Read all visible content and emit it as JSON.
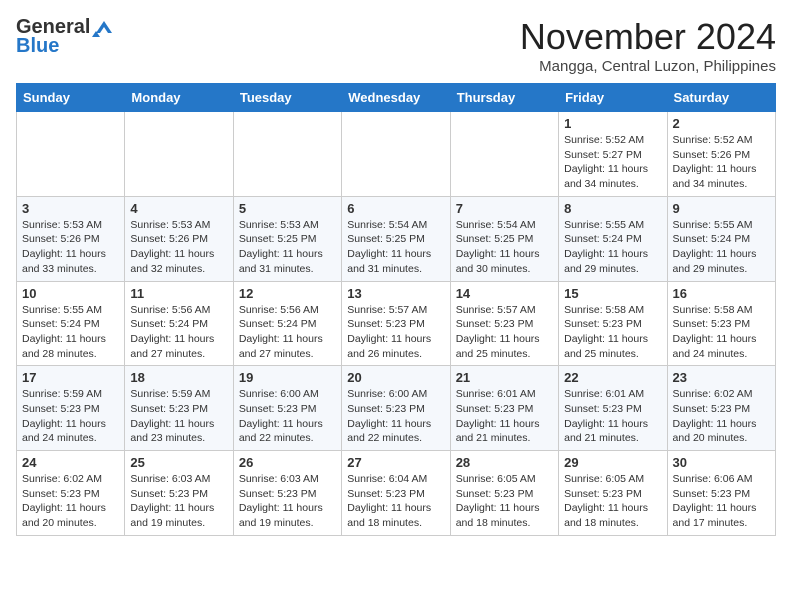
{
  "header": {
    "logo_line1": "General",
    "logo_line2": "Blue",
    "month_title": "November 2024",
    "subtitle": "Mangga, Central Luzon, Philippines"
  },
  "weekdays": [
    "Sunday",
    "Monday",
    "Tuesday",
    "Wednesday",
    "Thursday",
    "Friday",
    "Saturday"
  ],
  "weeks": [
    [
      {
        "day": "",
        "info": ""
      },
      {
        "day": "",
        "info": ""
      },
      {
        "day": "",
        "info": ""
      },
      {
        "day": "",
        "info": ""
      },
      {
        "day": "",
        "info": ""
      },
      {
        "day": "1",
        "info": "Sunrise: 5:52 AM\nSunset: 5:27 PM\nDaylight: 11 hours and 34 minutes."
      },
      {
        "day": "2",
        "info": "Sunrise: 5:52 AM\nSunset: 5:26 PM\nDaylight: 11 hours and 34 minutes."
      }
    ],
    [
      {
        "day": "3",
        "info": "Sunrise: 5:53 AM\nSunset: 5:26 PM\nDaylight: 11 hours and 33 minutes."
      },
      {
        "day": "4",
        "info": "Sunrise: 5:53 AM\nSunset: 5:26 PM\nDaylight: 11 hours and 32 minutes."
      },
      {
        "day": "5",
        "info": "Sunrise: 5:53 AM\nSunset: 5:25 PM\nDaylight: 11 hours and 31 minutes."
      },
      {
        "day": "6",
        "info": "Sunrise: 5:54 AM\nSunset: 5:25 PM\nDaylight: 11 hours and 31 minutes."
      },
      {
        "day": "7",
        "info": "Sunrise: 5:54 AM\nSunset: 5:25 PM\nDaylight: 11 hours and 30 minutes."
      },
      {
        "day": "8",
        "info": "Sunrise: 5:55 AM\nSunset: 5:24 PM\nDaylight: 11 hours and 29 minutes."
      },
      {
        "day": "9",
        "info": "Sunrise: 5:55 AM\nSunset: 5:24 PM\nDaylight: 11 hours and 29 minutes."
      }
    ],
    [
      {
        "day": "10",
        "info": "Sunrise: 5:55 AM\nSunset: 5:24 PM\nDaylight: 11 hours and 28 minutes."
      },
      {
        "day": "11",
        "info": "Sunrise: 5:56 AM\nSunset: 5:24 PM\nDaylight: 11 hours and 27 minutes."
      },
      {
        "day": "12",
        "info": "Sunrise: 5:56 AM\nSunset: 5:24 PM\nDaylight: 11 hours and 27 minutes."
      },
      {
        "day": "13",
        "info": "Sunrise: 5:57 AM\nSunset: 5:23 PM\nDaylight: 11 hours and 26 minutes."
      },
      {
        "day": "14",
        "info": "Sunrise: 5:57 AM\nSunset: 5:23 PM\nDaylight: 11 hours and 25 minutes."
      },
      {
        "day": "15",
        "info": "Sunrise: 5:58 AM\nSunset: 5:23 PM\nDaylight: 11 hours and 25 minutes."
      },
      {
        "day": "16",
        "info": "Sunrise: 5:58 AM\nSunset: 5:23 PM\nDaylight: 11 hours and 24 minutes."
      }
    ],
    [
      {
        "day": "17",
        "info": "Sunrise: 5:59 AM\nSunset: 5:23 PM\nDaylight: 11 hours and 24 minutes."
      },
      {
        "day": "18",
        "info": "Sunrise: 5:59 AM\nSunset: 5:23 PM\nDaylight: 11 hours and 23 minutes."
      },
      {
        "day": "19",
        "info": "Sunrise: 6:00 AM\nSunset: 5:23 PM\nDaylight: 11 hours and 22 minutes."
      },
      {
        "day": "20",
        "info": "Sunrise: 6:00 AM\nSunset: 5:23 PM\nDaylight: 11 hours and 22 minutes."
      },
      {
        "day": "21",
        "info": "Sunrise: 6:01 AM\nSunset: 5:23 PM\nDaylight: 11 hours and 21 minutes."
      },
      {
        "day": "22",
        "info": "Sunrise: 6:01 AM\nSunset: 5:23 PM\nDaylight: 11 hours and 21 minutes."
      },
      {
        "day": "23",
        "info": "Sunrise: 6:02 AM\nSunset: 5:23 PM\nDaylight: 11 hours and 20 minutes."
      }
    ],
    [
      {
        "day": "24",
        "info": "Sunrise: 6:02 AM\nSunset: 5:23 PM\nDaylight: 11 hours and 20 minutes."
      },
      {
        "day": "25",
        "info": "Sunrise: 6:03 AM\nSunset: 5:23 PM\nDaylight: 11 hours and 19 minutes."
      },
      {
        "day": "26",
        "info": "Sunrise: 6:03 AM\nSunset: 5:23 PM\nDaylight: 11 hours and 19 minutes."
      },
      {
        "day": "27",
        "info": "Sunrise: 6:04 AM\nSunset: 5:23 PM\nDaylight: 11 hours and 18 minutes."
      },
      {
        "day": "28",
        "info": "Sunrise: 6:05 AM\nSunset: 5:23 PM\nDaylight: 11 hours and 18 minutes."
      },
      {
        "day": "29",
        "info": "Sunrise: 6:05 AM\nSunset: 5:23 PM\nDaylight: 11 hours and 18 minutes."
      },
      {
        "day": "30",
        "info": "Sunrise: 6:06 AM\nSunset: 5:23 PM\nDaylight: 11 hours and 17 minutes."
      }
    ]
  ]
}
